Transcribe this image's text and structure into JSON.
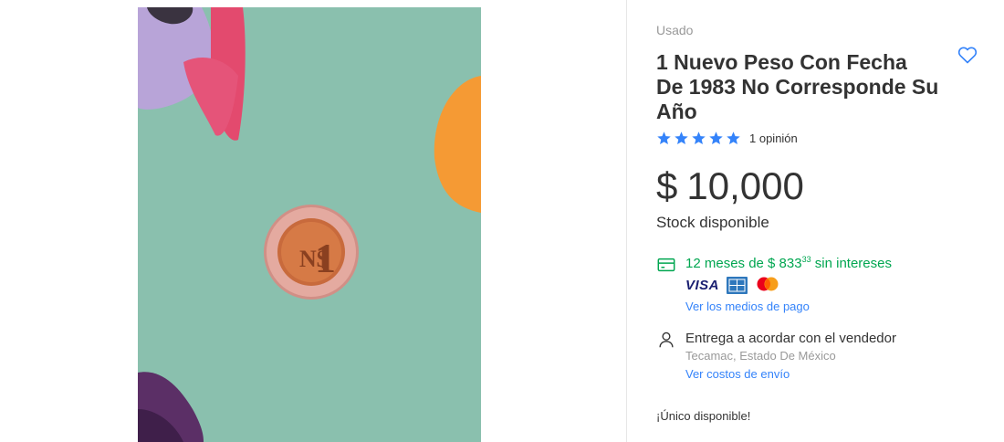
{
  "product": {
    "condition": "Usado",
    "title": "1 Nuevo Peso Con Fecha De 1983 No Corresponde Su Año",
    "rating": 5,
    "reviews_text": "1 opinión",
    "currency_symbol": "$",
    "price": "10,000",
    "stock_text": "Stock disponible",
    "availability_text": "¡Único disponible!"
  },
  "payment": {
    "installments_prefix": "12 meses de $ 833",
    "installments_cents": "33",
    "installments_suffix": " sin intereses",
    "card_visa": "VISA",
    "payment_methods_link": "Ver los medios de pago"
  },
  "shipping": {
    "delivery_text": "Entrega a acordar con el vendedor",
    "location": "Tecamac, Estado De México",
    "shipping_costs_link": "Ver costos de envío"
  },
  "icons": {
    "favorite": "heart-outline-icon",
    "star": "star-filled-icon",
    "credit_card": "credit-card-icon",
    "person": "person-icon",
    "amex": "amex-logo-icon",
    "mastercard": "mastercard-logo-icon"
  },
  "colors": {
    "accent": "#3483fa",
    "green": "#00a650",
    "text": "#333333",
    "muted": "#999999"
  }
}
